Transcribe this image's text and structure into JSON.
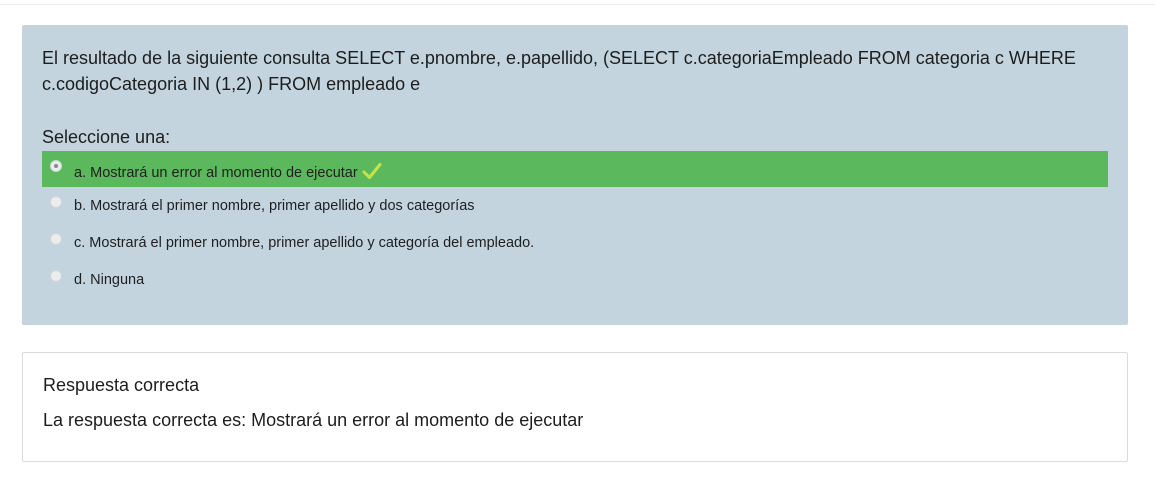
{
  "question": {
    "text": "El resultado de la siguiente consulta SELECT e.pnombre, e.papellido, (SELECT c.categoriaEmpleado FROM categoria c WHERE c.codigoCategoria IN (1,2) ) FROM empleado e",
    "prompt": "Seleccione una:",
    "answers": [
      {
        "label": "a. Mostrará un error al momento de ejecutar",
        "selected": true,
        "correct": true
      },
      {
        "label": "b. Mostrará el primer nombre, primer apellido y dos categorías",
        "selected": false,
        "correct": false
      },
      {
        "label": "c. Mostrará el primer nombre, primer apellido y categoría del empleado.",
        "selected": false,
        "correct": false
      },
      {
        "label": "d. Ninguna",
        "selected": false,
        "correct": false
      }
    ]
  },
  "feedback": {
    "title": "Respuesta correcta",
    "answer_text": "La respuesta correcta es: Mostrará un error al momento de ejecutar"
  },
  "colors": {
    "question_bg": "#c3d4de",
    "correct_bg": "#5cb85c",
    "check_icon": "#c6e34a"
  },
  "icons": {
    "correct_mark": "check-icon"
  }
}
